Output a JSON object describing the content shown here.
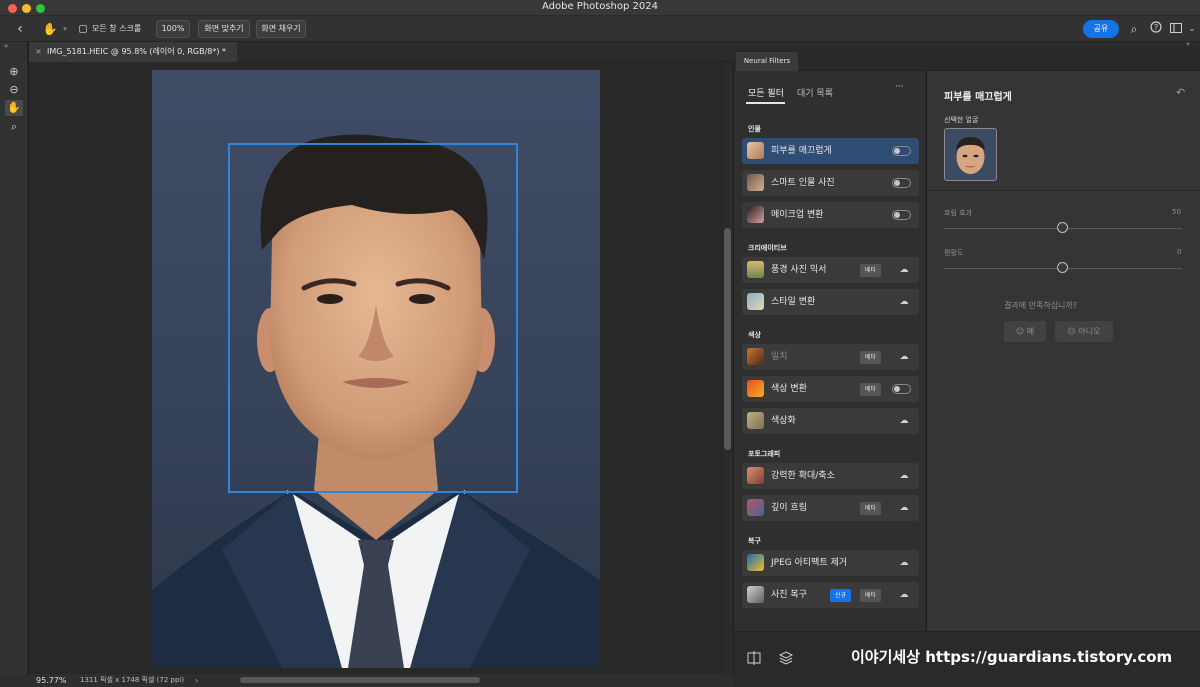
{
  "app": {
    "title": "Adobe Photoshop 2024"
  },
  "options_bar": {
    "scroll_all_label": "모든 창 스크롤",
    "zoom_100": "100%",
    "fit_screen": "화면 맞추기",
    "fill_screen": "화면 채우기",
    "share": "공유"
  },
  "document": {
    "tab_title": "IMG_5181.HEIC @ 95.8% (레이어 0, RGB/8*) *",
    "zoom": "95.77%",
    "info": "1311 픽셀 x 1748 픽셀 (72 ppi)"
  },
  "neural_filters": {
    "panel_title": "Neural Filters",
    "tab_all": "모든 필터",
    "tab_waitlist": "대기 목록",
    "more": "···",
    "sections": {
      "portrait": "인물",
      "creative": "크리에이티브",
      "color": "색상",
      "photography": "포토그래피",
      "restore": "복구"
    },
    "filters": {
      "skin_smoothing": "피부를 매끄럽게",
      "smart_portrait": "스마트 인물 사진",
      "makeup_transfer": "메이크업 변환",
      "landscape_mixer": "풍경 사진 믹서",
      "style_transfer": "스타일 변환",
      "harmonize": "일치",
      "color_transfer": "색상 변환",
      "colorize": "색상화",
      "super_zoom": "강력한 확대/축소",
      "depth_blur": "깊이 흐림",
      "jpeg_artifacts": "JPEG 아티팩트 제거",
      "photo_restore": "사진 복구"
    },
    "badges": {
      "beta": "베타",
      "new": "신규"
    },
    "detail": {
      "title": "피부를 매끄럽게",
      "selected_face_label": "선택한 얼굴",
      "blur_label": "흐림 효과",
      "blur_value": "50",
      "smoothness_label": "평활도",
      "smoothness_value": "0",
      "satisfied_question": "결과에 만족하십니까?",
      "yes": "예",
      "no": "아니오"
    }
  },
  "watermark": "이야기세상 https://guardians.tistory.com",
  "colors": {
    "accent": "#1473e6",
    "selection_box": "#2c86e0",
    "selected_row": "#2f4d73"
  }
}
